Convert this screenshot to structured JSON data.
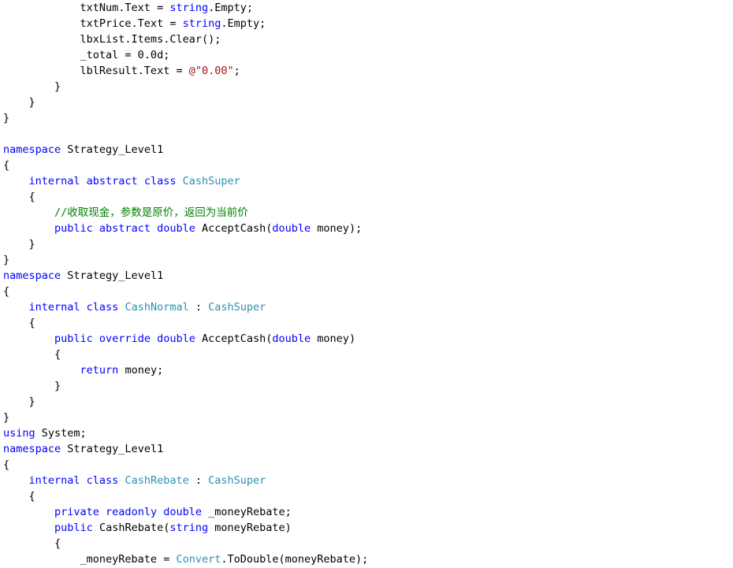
{
  "colors": {
    "keyword": "#0000ff",
    "type": "#2b91af",
    "string": "#a31515",
    "comment": "#008000",
    "text": "#000000",
    "background": "#ffffff"
  },
  "code": {
    "lines": [
      [
        {
          "k": "txt",
          "t": "            txtNum.Text = "
        },
        {
          "k": "kw",
          "t": "string"
        },
        {
          "k": "txt",
          "t": ".Empty;"
        }
      ],
      [
        {
          "k": "txt",
          "t": "            txtPrice.Text = "
        },
        {
          "k": "kw",
          "t": "string"
        },
        {
          "k": "txt",
          "t": ".Empty;"
        }
      ],
      [
        {
          "k": "txt",
          "t": "            lbxList.Items.Clear();"
        }
      ],
      [
        {
          "k": "txt",
          "t": "            _total = 0.0d;"
        }
      ],
      [
        {
          "k": "txt",
          "t": "            lblResult.Text = "
        },
        {
          "k": "str",
          "t": "@\"0.00\""
        },
        {
          "k": "txt",
          "t": ";"
        }
      ],
      [
        {
          "k": "txt",
          "t": "        }"
        }
      ],
      [
        {
          "k": "txt",
          "t": "    }"
        }
      ],
      [
        {
          "k": "txt",
          "t": "}"
        }
      ],
      [
        {
          "k": "txt",
          "t": ""
        }
      ],
      [
        {
          "k": "kw",
          "t": "namespace"
        },
        {
          "k": "txt",
          "t": " Strategy_Level1"
        }
      ],
      [
        {
          "k": "txt",
          "t": "{"
        }
      ],
      [
        {
          "k": "txt",
          "t": "    "
        },
        {
          "k": "kw",
          "t": "internal abstract class"
        },
        {
          "k": "txt",
          "t": " "
        },
        {
          "k": "type",
          "t": "CashSuper"
        }
      ],
      [
        {
          "k": "txt",
          "t": "    {"
        }
      ],
      [
        {
          "k": "txt",
          "t": "        "
        },
        {
          "k": "com",
          "t": "//收取现金，参数是原价，返回为当前价"
        }
      ],
      [
        {
          "k": "txt",
          "t": "        "
        },
        {
          "k": "kw",
          "t": "public abstract double"
        },
        {
          "k": "txt",
          "t": " AcceptCash("
        },
        {
          "k": "kw",
          "t": "double"
        },
        {
          "k": "txt",
          "t": " money);"
        }
      ],
      [
        {
          "k": "txt",
          "t": "    }"
        }
      ],
      [
        {
          "k": "txt",
          "t": "}"
        }
      ],
      [
        {
          "k": "kw",
          "t": "namespace"
        },
        {
          "k": "txt",
          "t": " Strategy_Level1"
        }
      ],
      [
        {
          "k": "txt",
          "t": "{"
        }
      ],
      [
        {
          "k": "txt",
          "t": "    "
        },
        {
          "k": "kw",
          "t": "internal class"
        },
        {
          "k": "txt",
          "t": " "
        },
        {
          "k": "type",
          "t": "CashNormal"
        },
        {
          "k": "txt",
          "t": " : "
        },
        {
          "k": "type",
          "t": "CashSuper"
        }
      ],
      [
        {
          "k": "txt",
          "t": "    {"
        }
      ],
      [
        {
          "k": "txt",
          "t": "        "
        },
        {
          "k": "kw",
          "t": "public override double"
        },
        {
          "k": "txt",
          "t": " AcceptCash("
        },
        {
          "k": "kw",
          "t": "double"
        },
        {
          "k": "txt",
          "t": " money)"
        }
      ],
      [
        {
          "k": "txt",
          "t": "        {"
        }
      ],
      [
        {
          "k": "txt",
          "t": "            "
        },
        {
          "k": "kw",
          "t": "return"
        },
        {
          "k": "txt",
          "t": " money;"
        }
      ],
      [
        {
          "k": "txt",
          "t": "        }"
        }
      ],
      [
        {
          "k": "txt",
          "t": "    }"
        }
      ],
      [
        {
          "k": "txt",
          "t": "}"
        }
      ],
      [
        {
          "k": "kw",
          "t": "using"
        },
        {
          "k": "txt",
          "t": " System;"
        }
      ],
      [
        {
          "k": "kw",
          "t": "namespace"
        },
        {
          "k": "txt",
          "t": " Strategy_Level1"
        }
      ],
      [
        {
          "k": "txt",
          "t": "{"
        }
      ],
      [
        {
          "k": "txt",
          "t": "    "
        },
        {
          "k": "kw",
          "t": "internal class"
        },
        {
          "k": "txt",
          "t": " "
        },
        {
          "k": "type",
          "t": "CashRebate"
        },
        {
          "k": "txt",
          "t": " : "
        },
        {
          "k": "type",
          "t": "CashSuper"
        }
      ],
      [
        {
          "k": "txt",
          "t": "    {"
        }
      ],
      [
        {
          "k": "txt",
          "t": "        "
        },
        {
          "k": "kw",
          "t": "private readonly double"
        },
        {
          "k": "txt",
          "t": " _moneyRebate;"
        }
      ],
      [
        {
          "k": "txt",
          "t": "        "
        },
        {
          "k": "kw",
          "t": "public"
        },
        {
          "k": "txt",
          "t": " CashRebate("
        },
        {
          "k": "kw",
          "t": "string"
        },
        {
          "k": "txt",
          "t": " moneyRebate)"
        }
      ],
      [
        {
          "k": "txt",
          "t": "        {"
        }
      ],
      [
        {
          "k": "txt",
          "t": "            _moneyRebate = "
        },
        {
          "k": "type",
          "t": "Convert"
        },
        {
          "k": "txt",
          "t": ".ToDouble(moneyRebate);"
        }
      ]
    ]
  }
}
